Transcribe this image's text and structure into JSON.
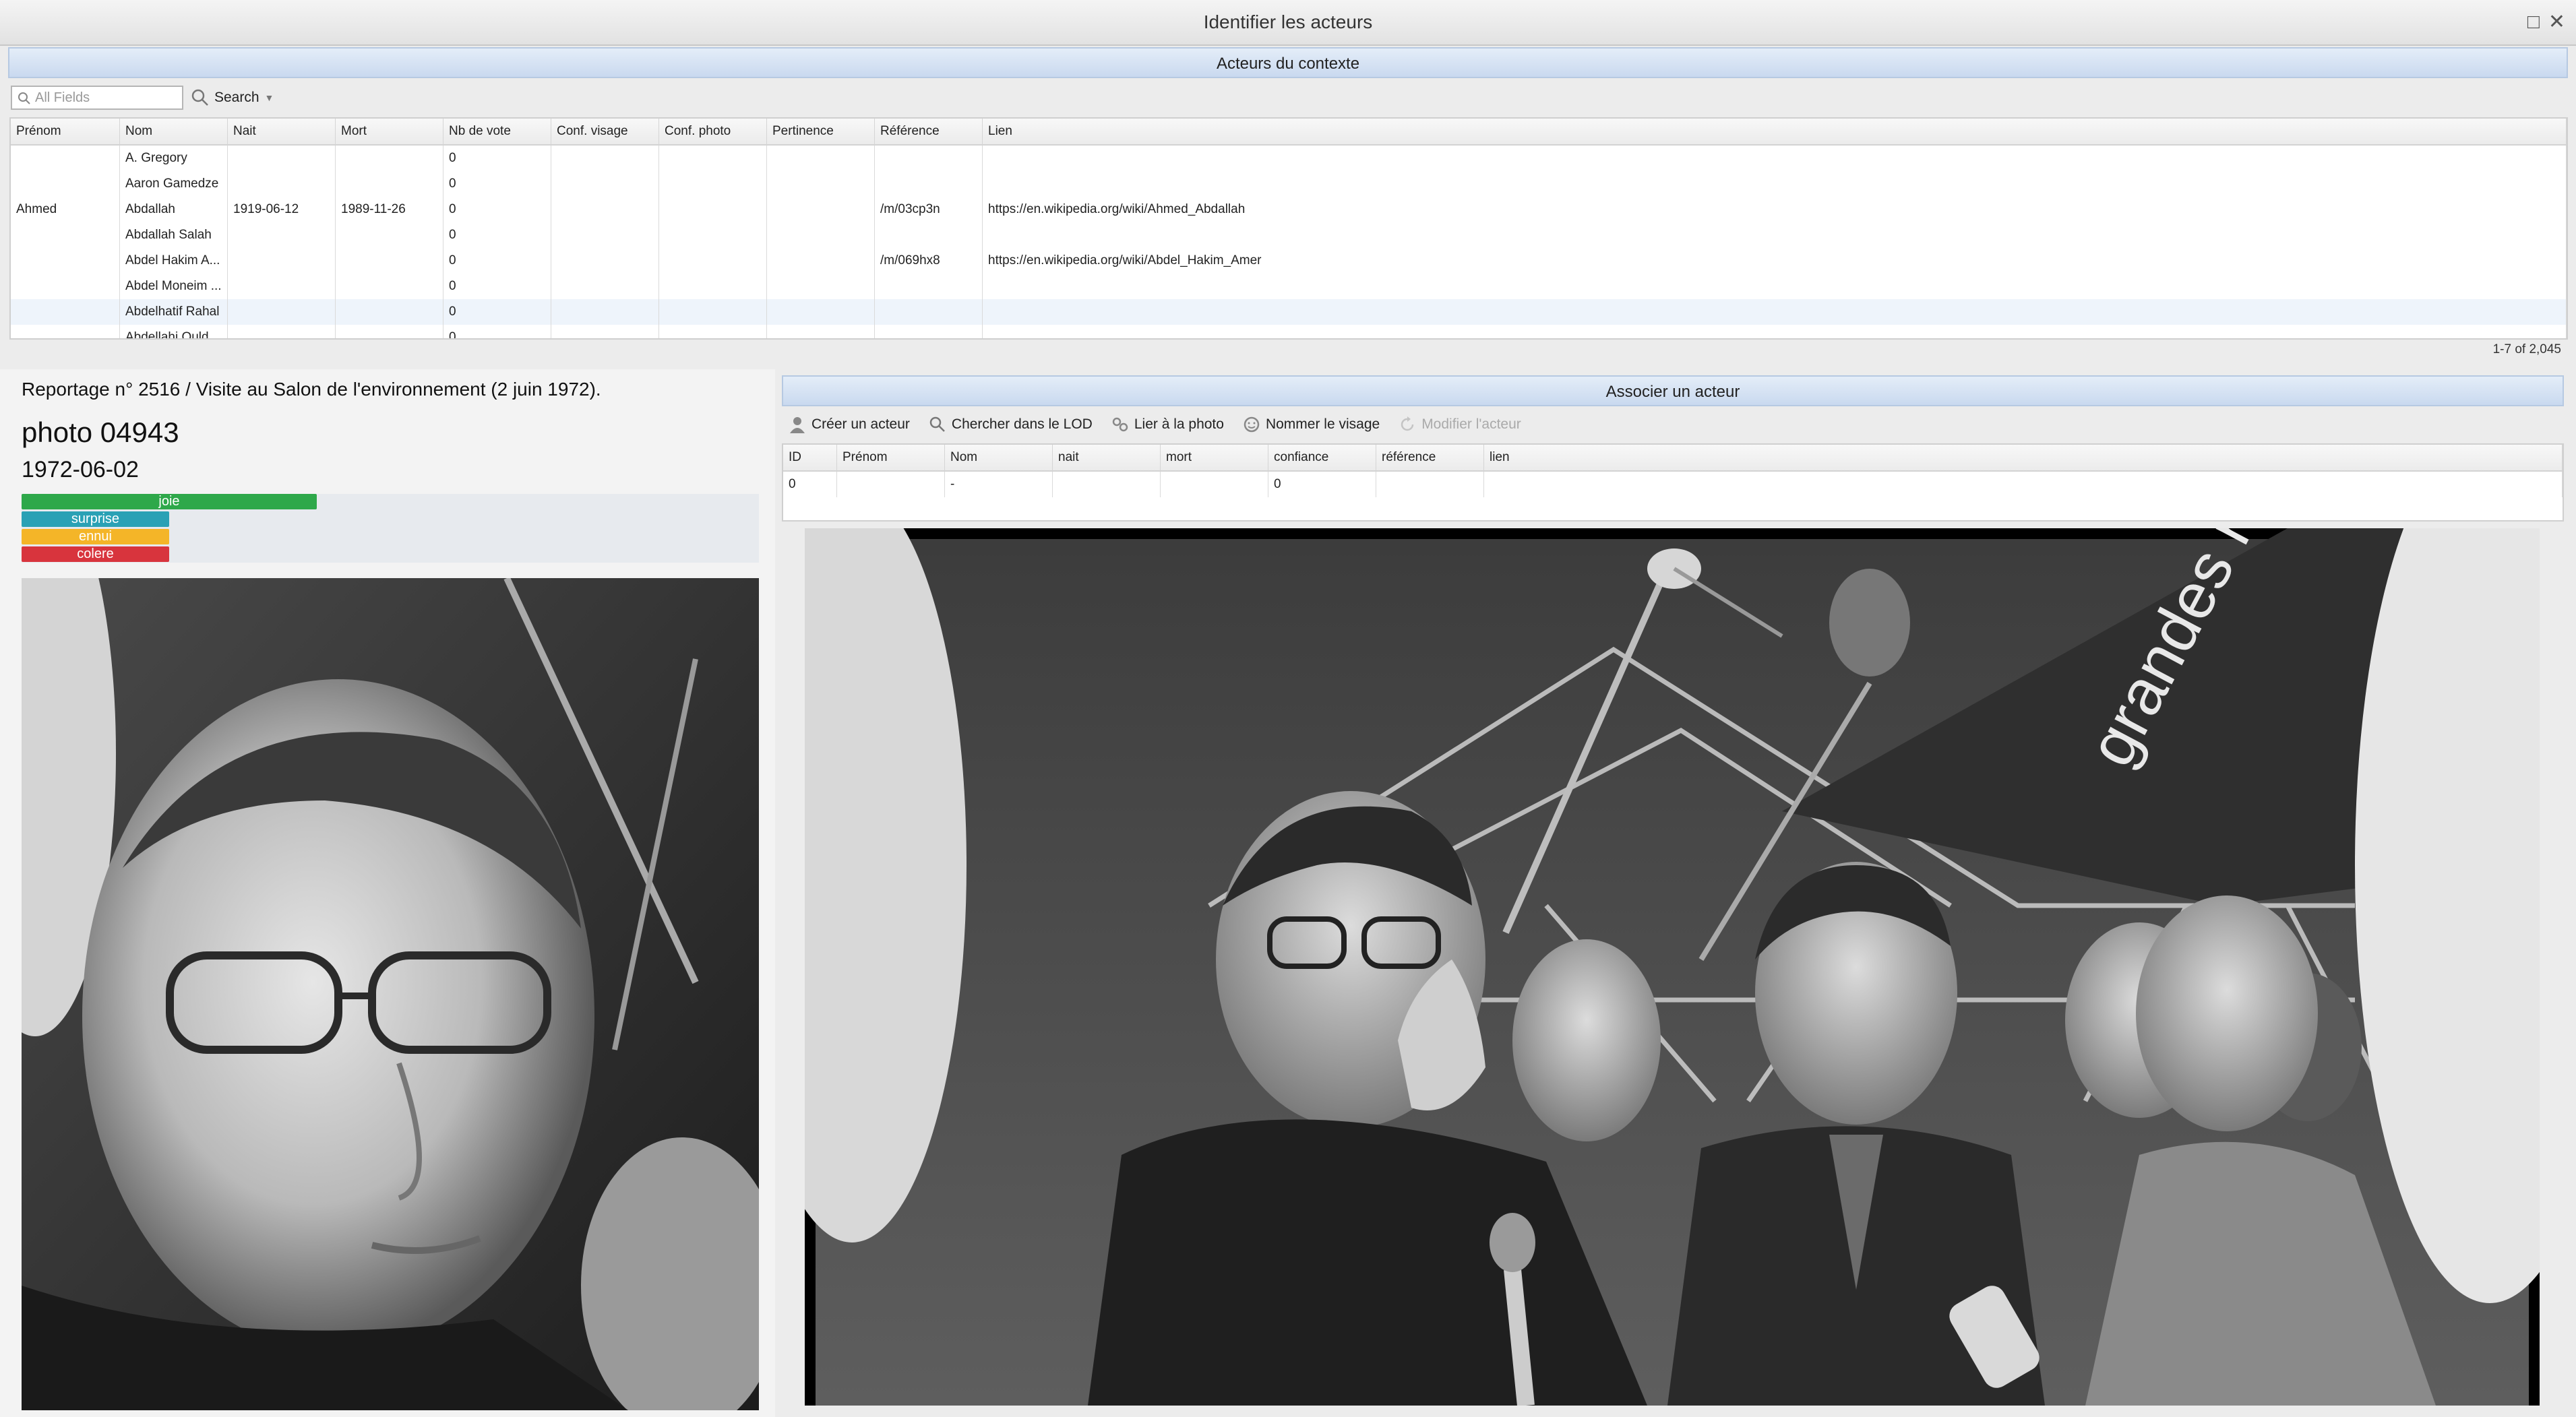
{
  "window": {
    "title": "Identifier les acteurs",
    "restore_icon": "restore-icon",
    "close_icon": "close-icon"
  },
  "context_panel": {
    "header": "Acteurs du contexte",
    "search": {
      "placeholder": "All Fields",
      "button_label": "Search"
    },
    "columns": [
      "Prénom",
      "Nom",
      "Nait",
      "Mort",
      "Nb de vote",
      "Conf. visage",
      "Conf. photo",
      "Pertinence",
      "Référence",
      "Lien"
    ],
    "rows": [
      [
        "",
        "A. Gregory",
        "",
        "",
        "0",
        "",
        "",
        "",
        "",
        ""
      ],
      [
        "",
        "Aaron Gamedze",
        "",
        "",
        "0",
        "",
        "",
        "",
        "",
        ""
      ],
      [
        "Ahmed",
        "Abdallah",
        "1919-06-12",
        "1989-11-26",
        "0",
        "",
        "",
        "",
        "/m/03cp3n",
        "https://en.wikipedia.org/wiki/Ahmed_Abdallah"
      ],
      [
        "",
        "Abdallah Salah",
        "",
        "",
        "0",
        "",
        "",
        "",
        "",
        ""
      ],
      [
        "",
        "Abdel Hakim A...",
        "",
        "",
        "0",
        "",
        "",
        "",
        "/m/069hx8",
        "https://en.wikipedia.org/wiki/Abdel_Hakim_Amer"
      ],
      [
        "",
        "Abdel Moneim ...",
        "",
        "",
        "0",
        "",
        "",
        "",
        "",
        ""
      ],
      [
        "",
        "Abdelhatif Rahal",
        "",
        "",
        "0",
        "",
        "",
        "",
        "",
        ""
      ],
      [
        "",
        "Abdellahi Ould ...",
        "",
        "",
        "0",
        "",
        "",
        "",
        "",
        ""
      ]
    ],
    "pager": "1-7 of 2,045"
  },
  "photo_info": {
    "report": "Reportage n° 2516 / Visite au Salon de l'environnement (2 juin 1972).",
    "photo_title": "photo 04943",
    "date": "1972-06-02",
    "emotions": [
      {
        "label": "joie",
        "color": "#2ea84a",
        "value": 0.4
      },
      {
        "label": "surprise",
        "color": "#2aa1b5",
        "value": 0.2
      },
      {
        "label": "ennui",
        "color": "#f4b528",
        "value": 0.2
      },
      {
        "label": "colere",
        "color": "#d8343d",
        "value": 0.2
      }
    ]
  },
  "associate_panel": {
    "header": "Associer un acteur",
    "toolbar": [
      {
        "label": "Créer un acteur",
        "icon": "user-icon",
        "enabled": true
      },
      {
        "label": "Chercher dans le LOD",
        "icon": "search-icon",
        "enabled": true
      },
      {
        "label": "Lier à la photo",
        "icon": "link-icon",
        "enabled": true
      },
      {
        "label": "Nommer le visage",
        "icon": "face-icon",
        "enabled": true
      },
      {
        "label": "Modifier l'acteur",
        "icon": "refresh-icon",
        "enabled": false
      }
    ],
    "columns": [
      "ID",
      "Prénom",
      "Nom",
      "nait",
      "mort",
      "confiance",
      "référence",
      "lien"
    ],
    "rows": [
      [
        "0",
        "",
        "-",
        "",
        "",
        "0",
        "",
        ""
      ]
    ]
  },
  "photo_sign": "grandes réalisations"
}
